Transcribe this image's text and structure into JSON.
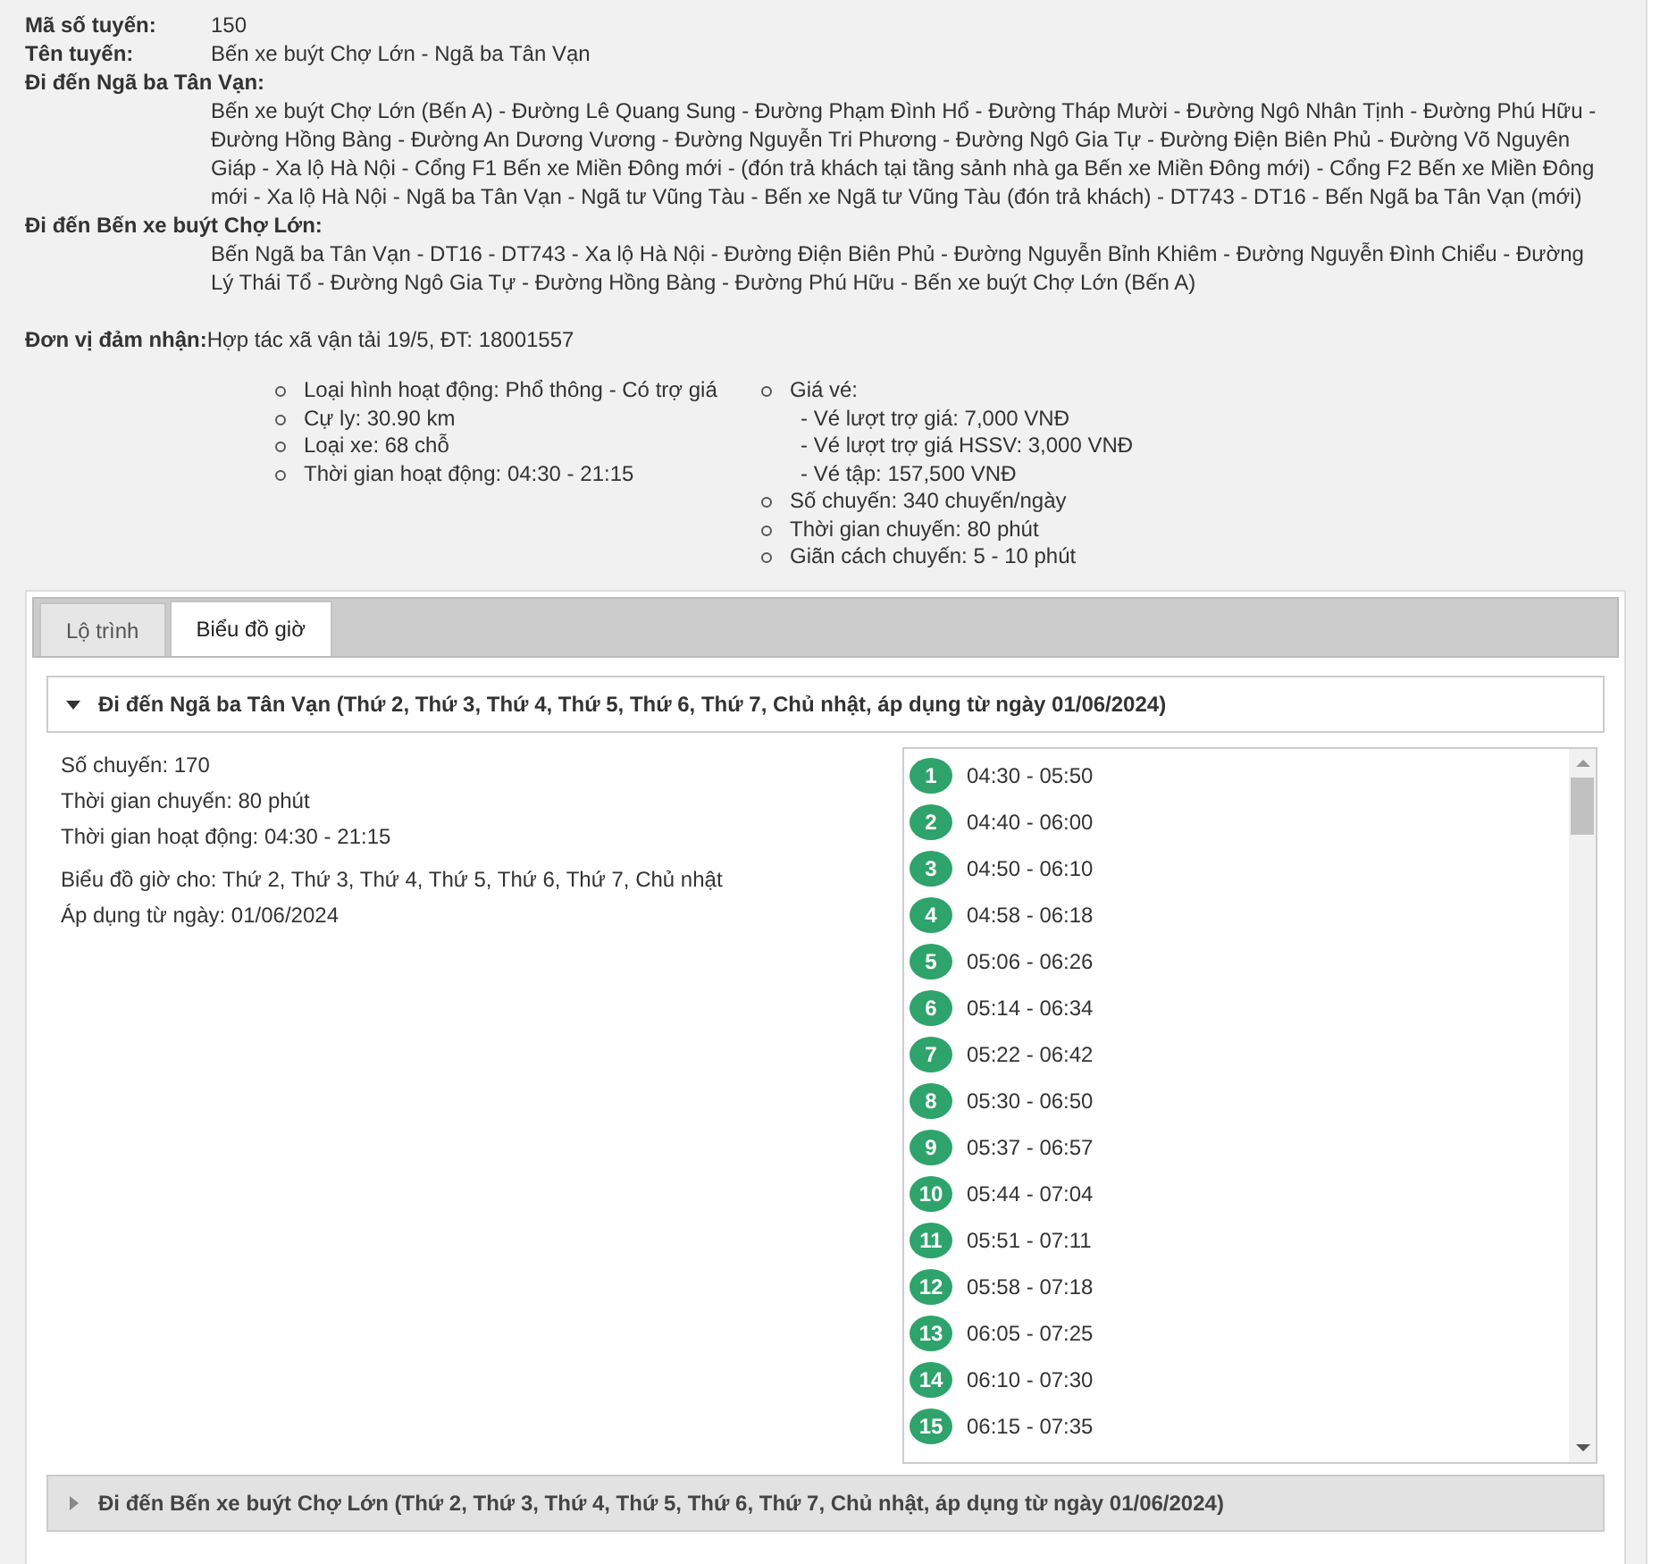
{
  "route_info": {
    "fields": [
      {
        "label": "Mã số tuyến:",
        "value": "150"
      },
      {
        "label": "Tên tuyến:",
        "value": "Bến xe buýt Chợ Lớn - Ngã ba Tân Vạn"
      }
    ],
    "directions": [
      {
        "label": "Đi đến Ngã ba Tân Vạn:",
        "path": "Bến xe buýt Chợ Lớn (Bến A) - Đường Lê Quang Sung - Đường Phạm Đình Hổ - Đường Tháp Mười - Đường Ngô Nhân Tịnh - Đường Phú Hữu - Đường Hồng Bàng - Đường An Dương Vương - Đường Nguyễn Tri Phương - Đường Ngô Gia Tự - Đường Điện Biên Phủ - Đường Võ Nguyên Giáp - Xa lộ Hà Nội - Cổng F1 Bến xe Miền Đông mới - (đón trả khách tại tầng sảnh nhà ga Bến xe Miền Đông mới) - Cổng F2 Bến xe Miền Đông mới - Xa lộ Hà Nội - Ngã ba Tân Vạn - Ngã tư Vũng Tàu - Bến xe Ngã tư Vũng Tàu (đón trả khách) - DT743 - DT16 - Bến Ngã ba Tân Vạn (mới)"
      },
      {
        "label": "Đi đến Bến xe buýt Chợ Lớn:",
        "path": "Bến Ngã ba Tân Vạn - DT16 - DT743 - Xa lộ Hà Nội - Đường Điện Biên Phủ - Đường Nguyễn Bỉnh Khiêm - Đường Nguyễn Đình Chiểu - Đường Lý Thái Tổ - Đường Ngô Gia Tự - Đường Hồng Bàng - Đường Phú Hữu - Bến xe buýt Chợ Lớn (Bến A)"
      }
    ],
    "operator": {
      "label": "Đơn vị đảm nhận:",
      "value": "Hợp tác xã vận tải 19/5, ĐT: 18001557"
    },
    "details_left": [
      {
        "text": "Loại hình hoạt động: Phổ thông - Có trợ giá"
      },
      {
        "text": "Cự ly: 30.90 km"
      },
      {
        "text": "Loại xe: 68 chỗ"
      },
      {
        "text": "Thời gian hoạt động: 04:30 - 21:15"
      }
    ],
    "details_right": [
      {
        "text": "Giá vé:",
        "sub": [
          "- Vé lượt trợ giá: 7,000 VNĐ",
          "- Vé lượt trợ giá HSSV: 3,000 VNĐ",
          "- Vé tập: 157,500 VNĐ"
        ]
      },
      {
        "text": "Số chuyến: 340 chuyến/ngày"
      },
      {
        "text": "Thời gian chuyến: 80 phút"
      },
      {
        "text": "Giãn cách chuyến: 5 - 10 phút"
      }
    ]
  },
  "tabs": [
    {
      "label": "Lộ trình",
      "selected": false
    },
    {
      "label": "Biểu đồ giờ",
      "selected": true
    }
  ],
  "schedules": [
    {
      "title": "Đi đến Ngã ba Tân Vạn (Thứ 2, Thứ 3, Thứ 4, Thứ 5, Thứ 6, Thứ 7, Chủ nhật, áp dụng từ ngày 01/06/2024)",
      "expanded": true,
      "summary": [
        "Số chuyến: 170",
        "Thời gian chuyến: 80 phút",
        "Thời gian hoạt động: 04:30 - 21:15"
      ],
      "notes": [
        "Biểu đồ giờ cho: Thứ 2, Thứ 3, Thứ 4, Thứ 5, Thứ 6, Thứ 7, Chủ nhật",
        "Áp dụng từ ngày: 01/06/2024"
      ],
      "trips": [
        {
          "number": "1",
          "time": "04:30 - 05:50"
        },
        {
          "number": "2",
          "time": "04:40 - 06:00"
        },
        {
          "number": "3",
          "time": "04:50 - 06:10"
        },
        {
          "number": "4",
          "time": "04:58 - 06:18"
        },
        {
          "number": "5",
          "time": "05:06 - 06:26"
        },
        {
          "number": "6",
          "time": "05:14 - 06:34"
        },
        {
          "number": "7",
          "time": "05:22 - 06:42"
        },
        {
          "number": "8",
          "time": "05:30 - 06:50"
        },
        {
          "number": "9",
          "time": "05:37 - 06:57"
        },
        {
          "number": "10",
          "time": "05:44 - 07:04"
        },
        {
          "number": "11",
          "time": "05:51 - 07:11"
        },
        {
          "number": "12",
          "time": "05:58 - 07:18"
        },
        {
          "number": "13",
          "time": "06:05 - 07:25"
        },
        {
          "number": "14",
          "time": "06:10 - 07:30"
        },
        {
          "number": "15",
          "time": "06:15 - 07:35"
        }
      ]
    },
    {
      "title": "Đi đến Bến xe buýt Chợ Lớn (Thứ 2, Thứ 3, Thứ 4, Thứ 5, Thứ 6, Thứ 7, Chủ nhật, áp dụng từ ngày 01/06/2024)",
      "expanded": false
    }
  ]
}
